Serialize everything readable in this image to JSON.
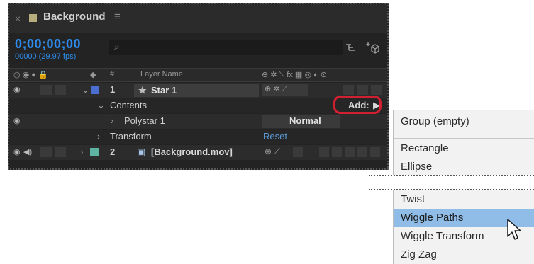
{
  "panel": {
    "tab": {
      "close": "×",
      "title": "Background",
      "menu": "≡"
    },
    "timecode": "0;00;00;00",
    "frames": "00000 (29.97 fps)",
    "search_icon": "⌕",
    "header": {
      "hash": "#",
      "layer_name": "Layer Name",
      "switch_icons": "⊕ ✲ ⟍ fx ▦ ◎ ◐ ⊙"
    },
    "rows": {
      "layer1": {
        "num": "1",
        "name": "Star 1"
      },
      "contents": {
        "label": "Contents",
        "add": "Add:"
      },
      "polystar": {
        "label": "Polystar 1",
        "mode": "Normal"
      },
      "transform": {
        "label": "Transform",
        "reset": "Reset"
      },
      "layer2": {
        "num": "2",
        "name": "[Background.mov]"
      }
    }
  },
  "menu": {
    "items": [
      "Group (empty)",
      "Rectangle",
      "Ellipse",
      "Twist",
      "Wiggle Paths",
      "Wiggle Transform",
      "Zig Zag"
    ],
    "highlighted": "Wiggle Paths"
  },
  "colors": {
    "timecode": "#2d8ceb",
    "highlight": "#8fbde8",
    "callout": "#d21f32",
    "label_blue": "#4a6fd0",
    "label_teal": "#5fb3a3"
  }
}
